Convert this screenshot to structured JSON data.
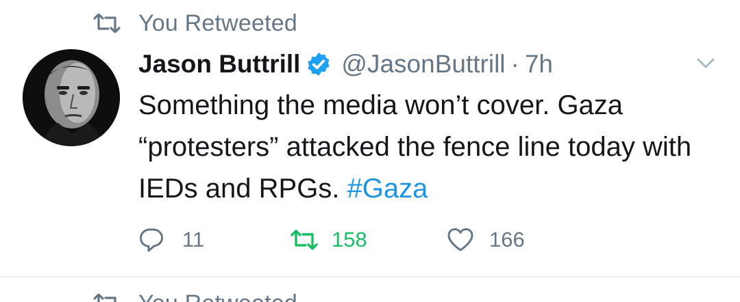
{
  "retweet_context": {
    "label": "You Retweeted"
  },
  "tweet": {
    "author": {
      "display_name": "Jason Buttrill",
      "handle": "@JasonButtrill",
      "verified": true
    },
    "separator": "·",
    "time_ago": "7h",
    "text_plain": "Something the media won’t cover. Gaza “protesters” attacked the fence line today with IEDs and RPGs.",
    "hashtag": "#Gaza",
    "actions": {
      "replies": "11",
      "retweets": "158",
      "likes": "166"
    }
  },
  "next_item": {
    "retweet_label": "You Retweeted"
  },
  "colors": {
    "text_primary": "#14171a",
    "text_secondary": "#657786",
    "link_blue": "#1b95e0",
    "retweet_green": "#17bf63",
    "verified_blue": "#1da1f2",
    "divider": "#e6ecf0"
  }
}
